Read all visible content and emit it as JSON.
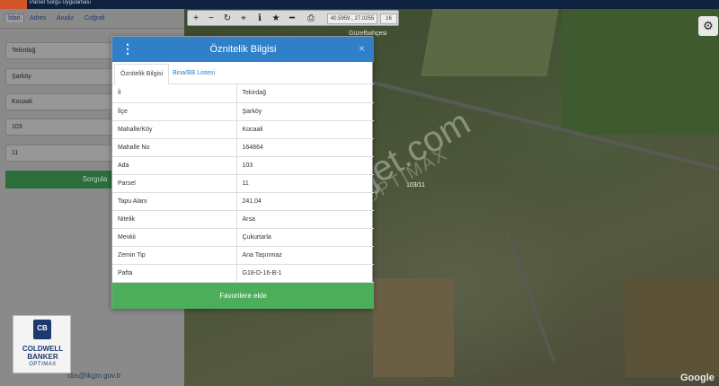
{
  "app": {
    "title": "Parsel Sorgu Uygulaması"
  },
  "left_panel": {
    "tabs": [
      {
        "label": "İdari"
      },
      {
        "label": "Adres"
      },
      {
        "label": "Analiz"
      },
      {
        "label": "Coğrafi"
      }
    ],
    "fields": [
      {
        "value": "Tekirdağ"
      },
      {
        "value": "Şarköy"
      },
      {
        "value": "Kocaali"
      },
      {
        "value": "103"
      },
      {
        "value": "11"
      }
    ],
    "query_button": "Sorgula",
    "footer_email": "cbs@tkgm.gov.tr"
  },
  "toolbar": {
    "icons": [
      "zoom-in-icon",
      "zoom-out-icon",
      "refresh-icon",
      "locate-icon",
      "info-icon",
      "favorite-icon",
      "measure-icon",
      "print-icon"
    ],
    "coords": "40.5959 , 27.0255",
    "zoom": "16"
  },
  "map": {
    "place_label": "Güzelbahçesi",
    "parcel_label": "103/11",
    "google_label": "Google"
  },
  "watermark": {
    "main": "emlakjet.com",
    "sub": "OPTIMAX"
  },
  "logo": {
    "line1": "COLDWELL",
    "line2": "BANKER",
    "line3": "OPTIMAX",
    "mark": "CB"
  },
  "modal": {
    "title": "Öznitelik Bilgisi",
    "close": "×",
    "tabs": [
      {
        "label": "Öznitelik Bilgisi"
      },
      {
        "label": "Bina/BB Listesi"
      }
    ],
    "rows": [
      {
        "key": "İl",
        "value": "Tekirdağ"
      },
      {
        "key": "İlçe",
        "value": "Şarköy"
      },
      {
        "key": "Mahalle/Köy",
        "value": "Kocaali"
      },
      {
        "key": "Mahalle No",
        "value": "164864"
      },
      {
        "key": "Ada",
        "value": "103"
      },
      {
        "key": "Parsel",
        "value": "11"
      },
      {
        "key": "Tapu Alanı",
        "value": "241,04"
      },
      {
        "key": "Nitelik",
        "value": "Arsa"
      },
      {
        "key": "Mevkii",
        "value": "Çukurtarla"
      },
      {
        "key": "Zemin Tip",
        "value": "Ana Taşınmaz"
      },
      {
        "key": "Pafta",
        "value": "G18-D-16-B-1"
      }
    ],
    "favorite_button": "Favorilere ekle"
  },
  "colors": {
    "modal_header": "#2f80c9",
    "favorite_button": "#4cae5a",
    "query_button": "#2b6e3c",
    "topbar": "#0f2240"
  }
}
